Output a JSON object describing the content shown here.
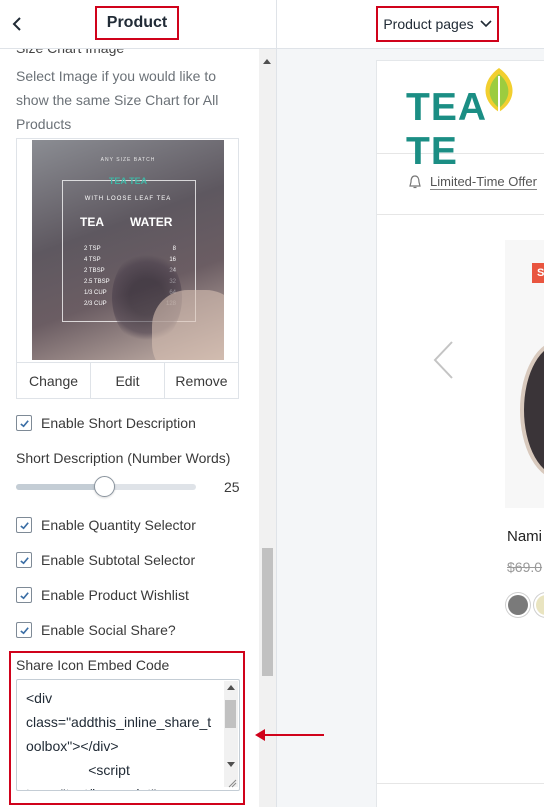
{
  "sidebar": {
    "title": "Product",
    "cut_heading": "Size Chart Image",
    "hint": "Select Image if you would like to show the same Size Chart for All Products",
    "image": {
      "brand": "TEA TEA",
      "small_top": "ANY SIZE BATCH",
      "subtitle": "WITH LOOSE LEAF TEA",
      "col_tea": "TEA",
      "col_water": "WATER",
      "rows": [
        [
          "2 TSP",
          "8"
        ],
        [
          "4 TSP",
          "16"
        ],
        [
          "2 TBSP",
          "24"
        ],
        [
          "2.5 TBSP",
          "32"
        ],
        [
          "1/3 CUP",
          "64"
        ],
        [
          "2/3 CUP",
          "128"
        ]
      ],
      "actions": [
        "Change",
        "Edit",
        "Remove"
      ]
    },
    "enable_short_description": "Enable Short Description",
    "short_desc_label": "Short Description (Number Words)",
    "short_desc_value": "25",
    "short_desc_fraction": 0.49,
    "checkboxes": [
      "Enable Quantity Selector",
      "Enable Subtotal Selector",
      "Enable Product Wishlist",
      "Enable Social Share?"
    ],
    "share_label": "Share Icon Embed Code",
    "share_code": "<div\nclass=\"addthis_inline_share_toolbox\"></div>\n                <script\ntype=\"text/javascript\"",
    "highlight_color": "#d0021b"
  },
  "topbar": {
    "page_selector": "Product pages"
  },
  "preview": {
    "logo": "TEA TE",
    "promo": "Limited-Time Offer",
    "badge": "S",
    "product_name": "Nami",
    "price": "$69.0",
    "brand_color": "#1b8e84"
  }
}
